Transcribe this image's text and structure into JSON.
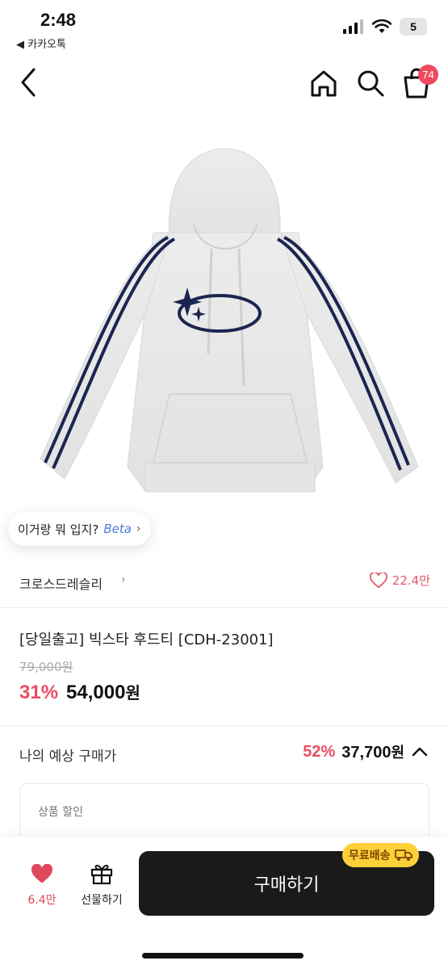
{
  "status_bar": {
    "time": "2:48",
    "back_app": "◀ 카카오톡",
    "battery": "5"
  },
  "nav": {
    "cart_count": "74"
  },
  "product": {
    "ai_chip_text": "이거랑 뭐 입지?",
    "ai_chip_beta": "Beta",
    "brand": "크로스드레슬리",
    "likes": "22.4만",
    "title": "[당일출고] 빅스타 후드티 [CDH-23001]",
    "original_price": "79,000원",
    "discount": "31%",
    "final_price_number": "54,000",
    "currency": "원"
  },
  "expected": {
    "label": "나의 예상 구매가",
    "discount": "52%",
    "price_number": "37,700",
    "currency": "원"
  },
  "detail": {
    "label": "상품 할인"
  },
  "bottom_bar": {
    "like_count": "6.4만",
    "gift_label": "선물하기",
    "buy_label": "구매하기",
    "shipping_badge": "무료배송"
  },
  "colors": {
    "accent": "#ea4d63",
    "buy_button": "#1a1a1a",
    "shipping_badge": "#ffcf3a"
  }
}
